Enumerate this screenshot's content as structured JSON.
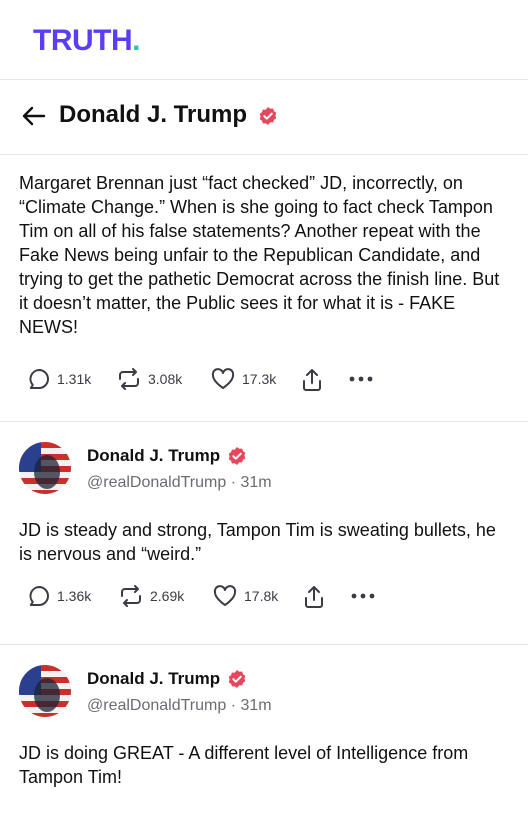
{
  "app": {
    "logo_main": "TRUTH",
    "logo_dot": "."
  },
  "header": {
    "title": "Donald J. Trump"
  },
  "posts": [
    {
      "text": "Margaret Brennan just “fact checked” JD, incorrectly, on “Climate Change.” When is she going to fact check Tampon Tim on all of his false statements? Another repeat with the Fake News being unfair to the Republican Candidate, and trying to get the pathetic Democrat across the finish line. But it doesn’t matter, the Public sees it for what it is - FAKE NEWS!",
      "replies": "1.31k",
      "retruths": "3.08k",
      "likes": "17.3k"
    },
    {
      "author": "Donald J. Trump",
      "handle": "@realDonaldTrump · 31m",
      "text": "JD is steady and strong, Tampon Tim is sweating bullets, he is nervous and “weird.”",
      "replies": "1.36k",
      "retruths": "2.69k",
      "likes": "17.8k"
    },
    {
      "author": "Donald J. Trump",
      "handle": "@realDonaldTrump · 31m",
      "text": "JD is doing GREAT - A different level of Intelligence from Tampon Tim!"
    }
  ],
  "colors": {
    "brand": "#5b3df5",
    "brand_dot": "#20c9b5",
    "verified": "#e5485c"
  },
  "icons": [
    "back-arrow-icon",
    "verified-badge-icon",
    "reply-icon",
    "retruth-icon",
    "like-icon",
    "share-icon",
    "more-icon"
  ]
}
